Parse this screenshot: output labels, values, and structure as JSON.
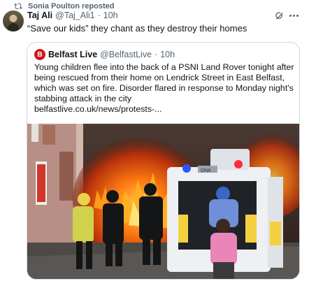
{
  "repost": {
    "label": "Sonia Poulton reposted"
  },
  "post": {
    "author_name": "Taj Ali",
    "author_handle": "@Taj_Ali1",
    "separator": "·",
    "time": "10h",
    "text": "“Save our kids” they chant as they destroy their homes"
  },
  "quote": {
    "logo_letter": "B",
    "author_name": "Belfast Live",
    "author_handle": "@BelfastLive",
    "separator": "·",
    "time": "10h",
    "text": "Young children flee into the back of a PSNI Land Rover tonight after being rescued from their home on Lendrick Street in East Belfast, which was set on fire. Disorder flared in response to Monday night's stabbing attack in the city",
    "link": "belfastlive.co.uk/news/protests-...",
    "image_van_text": "DNA"
  },
  "icons": {
    "repost": "repost-icon",
    "grok": "grok-icon",
    "more": "more-icon"
  },
  "colors": {
    "brand_red": "#d0181c",
    "secondary_text": "#536471",
    "border": "#cfd9de"
  }
}
